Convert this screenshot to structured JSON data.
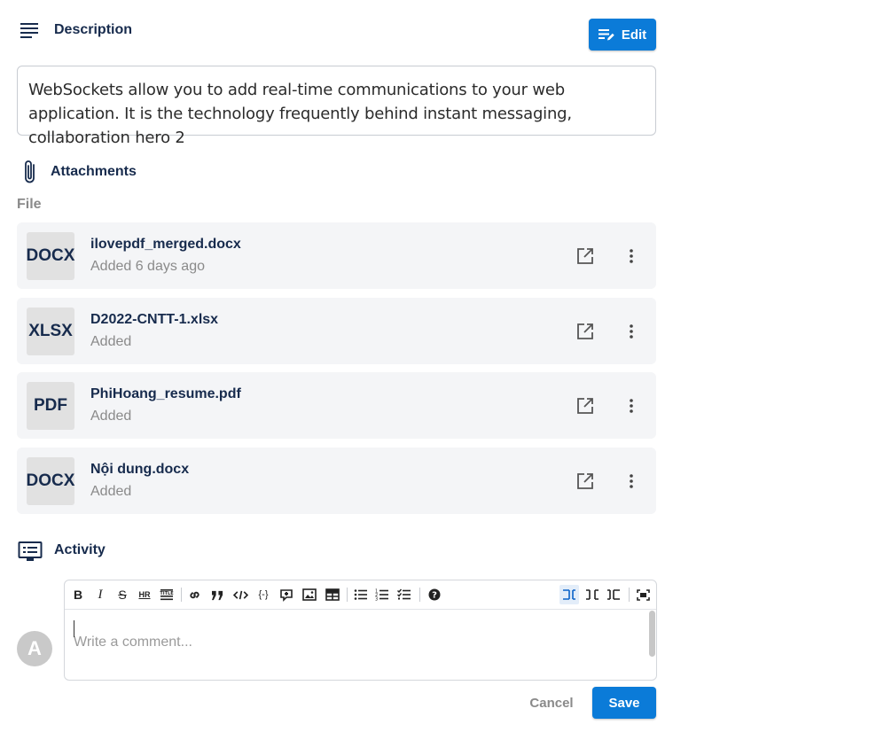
{
  "description": {
    "title": "Description",
    "edit_label": "Edit",
    "text": "WebSockets allow you to add real-time communications to your web application. It is the technology frequently behind instant messaging, collaboration hero  2"
  },
  "attachments": {
    "title": "Attachments",
    "file_label": "File",
    "items": [
      {
        "type": "DOCX",
        "name": "ilovepdf_merged.docx",
        "added": "Added 6 days ago"
      },
      {
        "type": "XLSX",
        "name": "D2022-CNTT-1.xlsx",
        "added": "Added"
      },
      {
        "type": "PDF",
        "name": "PhiHoang_resume.pdf",
        "added": "Added"
      },
      {
        "type": "DOCX",
        "name": "Nội dung.docx",
        "added": "Added"
      }
    ]
  },
  "activity": {
    "title": "Activity",
    "avatar_initial": "A",
    "comment_placeholder": "Write a comment...",
    "toolbar": {
      "bold": "B",
      "italic": "I",
      "strike": "S",
      "hr": "HR",
      "title": "TITLE",
      "code_block": "{-}"
    },
    "cancel_label": "Cancel",
    "save_label": "Save"
  },
  "colors": {
    "accent": "#0b7bd8",
    "text": "#172b4d",
    "muted": "#8a8a8a",
    "card_bg": "#f4f5f7"
  }
}
